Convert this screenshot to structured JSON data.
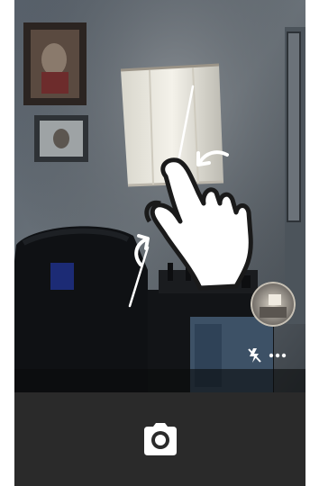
{
  "app": {
    "mode": "camera-viewfinder"
  },
  "icons": {
    "shutter": "camera-icon",
    "flash": "flash-off-icon",
    "more": "more-horizontal-icon",
    "gallery": "gallery-thumbnail",
    "gesture": "pinch-zoom-hand-icon"
  },
  "colors": {
    "bottom_bar": "#2a2a2a",
    "icon": "#ffffff"
  }
}
